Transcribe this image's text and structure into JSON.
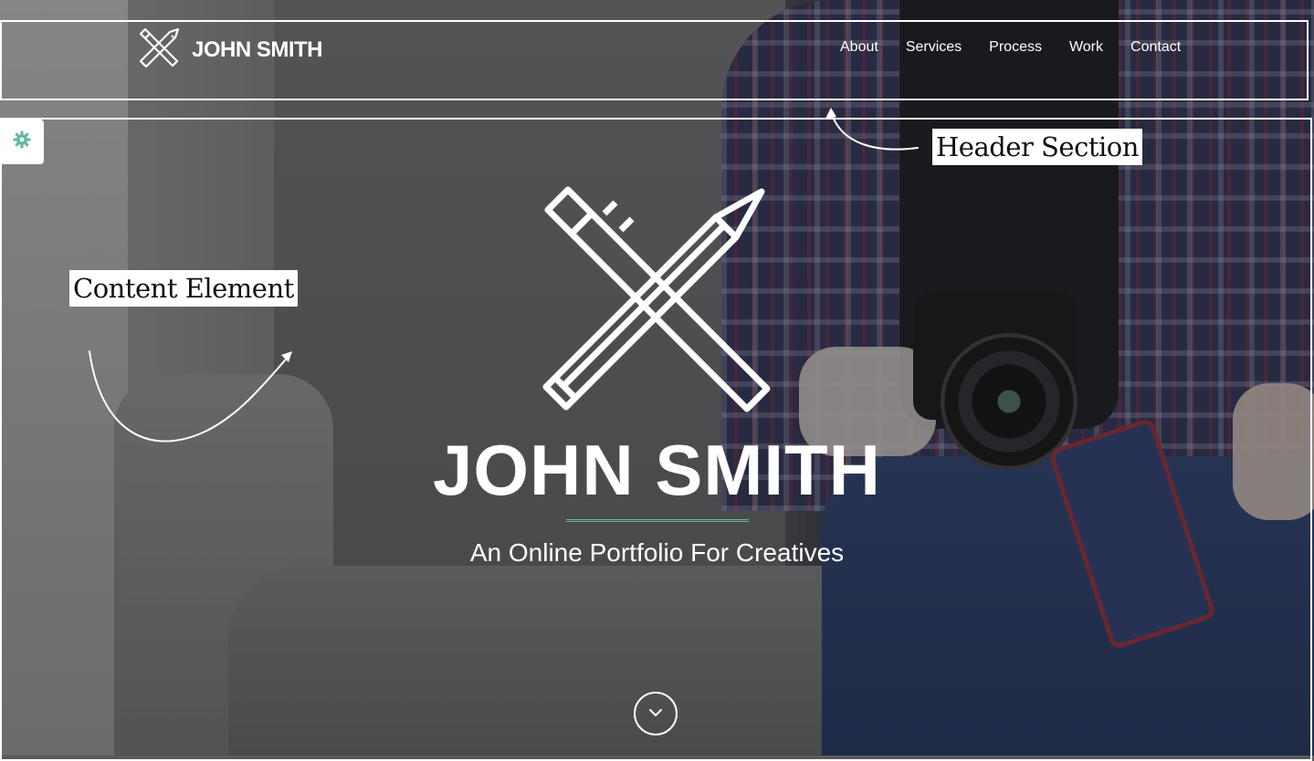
{
  "header": {
    "brand_name": "JOHN SMITH",
    "brand_icon": "pencil-ruler-cross-icon",
    "nav": [
      "About",
      "Services",
      "Process",
      "Work",
      "Contact"
    ]
  },
  "settings": {
    "icon": "gear-icon",
    "color": "#63b9a3"
  },
  "hero": {
    "logo_icon": "pencil-ruler-cross-icon",
    "title": "JOHN SMITH",
    "subtitle": "An Online Portfolio For Creatives",
    "divider_color": "#63b9a3",
    "scroll_icon": "chevron-down-icon"
  },
  "annotations": {
    "header_label": "Header Section",
    "content_label": "Content Element"
  }
}
